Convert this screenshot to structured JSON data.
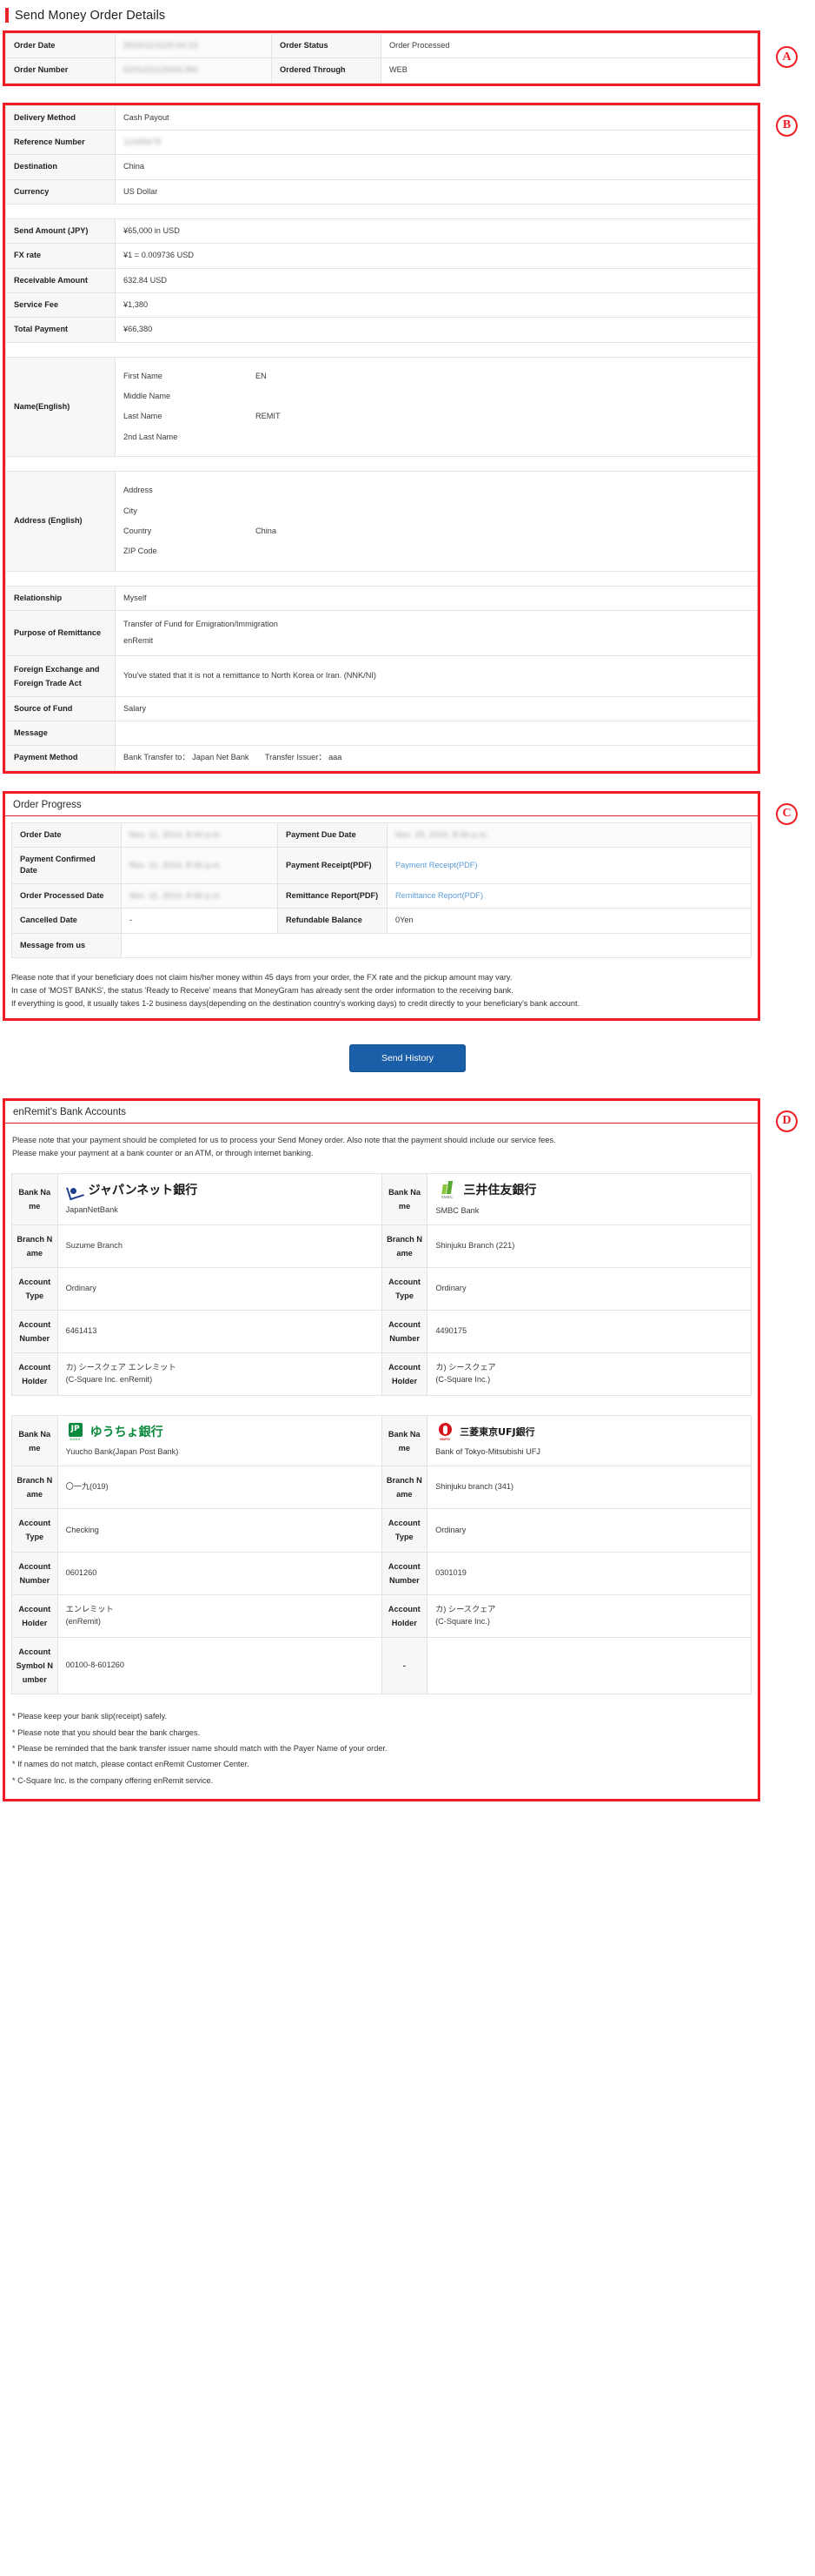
{
  "page": {
    "title": "Send Money Order Details"
  },
  "annotations": {
    "a": "A",
    "b": "B",
    "c": "C",
    "d": "D"
  },
  "section_a": {
    "rows": [
      {
        "label1": "Order Date",
        "value1": "2014/11/1120:44:13",
        "redacted1": true,
        "label2": "Order Status",
        "value2": "Order Processed",
        "redacted2": false
      },
      {
        "label1": "Order Number",
        "value1": "S20141112044L394",
        "redacted1": true,
        "label2": "Ordered Through",
        "value2": "WEB",
        "redacted2": false
      }
    ]
  },
  "section_b": {
    "rows_top": [
      {
        "label": "Delivery Method",
        "value": "Cash Payout",
        "redacted": false
      },
      {
        "label": "Reference Number",
        "value": "12345678",
        "redacted": true
      },
      {
        "label": "Destination",
        "value": "China",
        "redacted": false
      },
      {
        "label": "Currency",
        "value": "US Dollar",
        "redacted": false
      }
    ],
    "rows_amount": [
      {
        "label": "Send Amount (JPY)",
        "value": "¥65,000 in USD"
      },
      {
        "label": "FX rate",
        "value": "¥1 = 0.009736 USD"
      },
      {
        "label": "Receivable Amount",
        "value": "632.84 USD"
      },
      {
        "label": "Service Fee",
        "value": "¥1,380"
      },
      {
        "label": "Total Payment",
        "value": "¥66,380"
      }
    ],
    "name_label": "Name(English)",
    "name_fields": [
      {
        "key": "First Name",
        "value": "EN"
      },
      {
        "key": "Middle Name",
        "value": ""
      },
      {
        "key": "Last Name",
        "value": "REMIT"
      },
      {
        "key": "2nd Last Name",
        "value": ""
      }
    ],
    "address_label": "Address (English)",
    "address_fields": [
      {
        "key": "Address",
        "value": ""
      },
      {
        "key": "City",
        "value": ""
      },
      {
        "key": "Country",
        "value": "China"
      },
      {
        "key": "ZIP Code",
        "value": ""
      }
    ],
    "rows_bottom": [
      {
        "label": "Relationship",
        "value": "Myself",
        "line2": ""
      },
      {
        "label": "Purpose of Remittance",
        "value": "Transfer of Fund for Emigration/Immigration",
        "line2": "enRemit"
      },
      {
        "label": "Foreign Exchange and Foreign Trade Act",
        "value": "You've stated that it is not a remittance to North Korea or Iran. (NNK/NI)",
        "line2": ""
      },
      {
        "label": "Source of Fund",
        "value": "Salary",
        "line2": ""
      },
      {
        "label": "Message",
        "value": "",
        "line2": ""
      },
      {
        "label": "Payment Method",
        "value": "Bank Transfer to： Japan Net Bank　　Transfer Issuer： aaa",
        "line2": ""
      }
    ]
  },
  "section_c": {
    "heading": "Order Progress",
    "rows": [
      {
        "label1": "Order Date",
        "value1": "Nov. 11, 2014, 8:44 p.m.",
        "redacted1": true,
        "label2": "Payment Due Date",
        "value2": "Nov. 18, 2014, 8:44 p.m.",
        "redacted2": true,
        "link2": false
      },
      {
        "label1": "Payment Confirmed Date",
        "value1": "Nov. 11, 2014, 8:46 p.m.",
        "redacted1": true,
        "label2": "Payment Receipt(PDF)",
        "value2": "Payment Receipt(PDF)",
        "redacted2": false,
        "link2": true
      },
      {
        "label1": "Order Processed Date",
        "value1": "Nov. 11, 2014, 8:46 p.m.",
        "redacted1": true,
        "label2": "Remittance Report(PDF)",
        "value2": "Remittance Report(PDF)",
        "redacted2": false,
        "link2": true
      },
      {
        "label1": "Cancelled Date",
        "value1": "-",
        "redacted1": false,
        "label2": "Refundable Balance",
        "value2": "0Yen",
        "redacted2": false,
        "link2": false
      },
      {
        "label1": "Message from us",
        "value1": "",
        "redacted1": false,
        "label2": "",
        "value2": "",
        "redacted2": false,
        "link2": false
      }
    ],
    "note_lines": [
      "Please note that if your beneficiary does not claim his/her money within 45 days from your order, the FX rate and the pickup amount may vary.",
      "In case of 'MOST BANKS', the status 'Ready to Receive' means that MoneyGram has already sent the order information to the receiving bank.",
      "If everything is good, it usually takes 1-2 business days(depending on the destination country's working days) to credit directly to your beneficiary's bank account."
    ]
  },
  "send_history_button": {
    "label": "Send History"
  },
  "section_d": {
    "heading": "enRemit's Bank Accounts",
    "intro_lines": [
      "Please note that your payment should be completed for us to process your Send Money order. Also note that the payment should include our service fees.",
      "Please make your payment at a bank counter or an ATM, or through internet banking."
    ],
    "labels": {
      "bank_name": "Bank Name",
      "branch_name": "Branch Name",
      "account_type": "Account Type",
      "account_number": "Account Number",
      "account_holder": "Account Holder",
      "account_symbol_number": "Account Symbol Number"
    },
    "table1": {
      "left": {
        "logo": "japannetbank-logo",
        "bank_name_jp": "ジャパンネット銀行",
        "bank_name_en": "JapanNetBank",
        "branch_name": "Suzume Branch",
        "account_type": "Ordinary",
        "account_number": "6461413",
        "account_holder_jp": "カ) シースクェア エンレミット",
        "account_holder_en": "(C-Square Inc. enRemit)"
      },
      "right": {
        "logo": "smbc-logo",
        "bank_name_jp": "三井住友銀行",
        "bank_name_en": "SMBC Bank",
        "branch_name": "Shinjuku Branch (221)",
        "account_type": "Ordinary",
        "account_number": "4490175",
        "account_holder_jp": "カ) シースクェア",
        "account_holder_en": "(C-Square Inc.)"
      }
    },
    "table2": {
      "left": {
        "logo": "yuucho-logo",
        "bank_name_jp": "ゆうちょ銀行",
        "bank_name_en": "Yuucho Bank(Japan Post Bank)",
        "branch_name": "〇一九(019)",
        "account_type": "Checking",
        "account_number": "0601260",
        "account_holder_jp": "エンレミット",
        "account_holder_en": "(enRemit)",
        "account_symbol_number": "00100-8-601260"
      },
      "right": {
        "logo": "mufg-logo",
        "bank_name_jp": "三菱東京UFJ銀行",
        "bank_name_en": "Bank of Tokyo-Mitsubishi UFJ",
        "branch_name": "Shinjuku branch (341)",
        "account_type": "Ordinary",
        "account_number": "0301019",
        "account_holder_jp": "カ) シースクェア",
        "account_holder_en": "(C-Square Inc.)",
        "account_symbol_number": "-"
      }
    },
    "notes": [
      "* Please keep your bank slip(receipt) safely.",
      "* Please note that you should bear the bank charges.",
      "* Please be reminded that the bank transfer issuer name should match with the Payer Name of your order.",
      "* If names do not match, please contact enRemit Customer Center.",
      "* C-Square Inc. is the company offering enRemit service."
    ]
  }
}
